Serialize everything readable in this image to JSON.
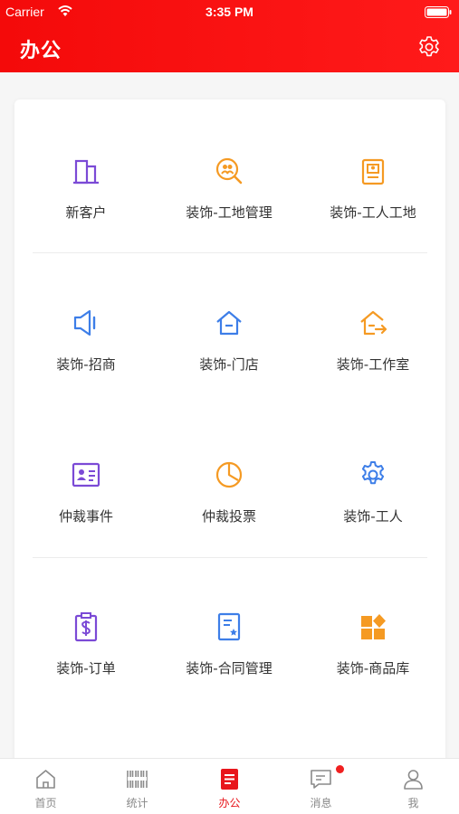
{
  "status_bar": {
    "carrier": "Carrier",
    "time": "3:35 PM"
  },
  "header": {
    "title": "办公",
    "settings_icon": "gear-icon"
  },
  "colors": {
    "header_red": "#f40a0a",
    "purple": "#7b4ad6",
    "orange": "#f59a23",
    "blue": "#3d7ee8",
    "active_red": "#e8161c"
  },
  "grid": [
    {
      "label": "新客户",
      "icon": "building-icon",
      "color": "#7b4ad6"
    },
    {
      "label": "装饰-工地管理",
      "icon": "search-people-icon",
      "color": "#f59a23"
    },
    {
      "label": "装饰-工人工地",
      "icon": "id-card-icon",
      "color": "#f59a23"
    },
    {
      "label": "装饰-招商",
      "icon": "speaker-icon",
      "color": "#3d7ee8"
    },
    {
      "label": "装饰-门店",
      "icon": "home-icon",
      "color": "#3d7ee8"
    },
    {
      "label": "装饰-工作室",
      "icon": "home-export-icon",
      "color": "#f59a23"
    },
    {
      "label": "仲裁事件",
      "icon": "contact-card-icon",
      "color": "#7b4ad6"
    },
    {
      "label": "仲裁投票",
      "icon": "pie-chart-icon",
      "color": "#f59a23"
    },
    {
      "label": "装饰-工人",
      "icon": "gear-icon",
      "color": "#3d7ee8"
    },
    {
      "label": "装饰-订单",
      "icon": "clipboard-dollar-icon",
      "color": "#7b4ad6"
    },
    {
      "label": "装饰-合同管理",
      "icon": "contract-icon",
      "color": "#3d7ee8"
    },
    {
      "label": "装饰-商品库",
      "icon": "grid-diamond-icon",
      "color": "#f59a23"
    }
  ],
  "tabbar": [
    {
      "label": "首页",
      "icon": "home-icon",
      "active": false
    },
    {
      "label": "统计",
      "icon": "barcode-icon",
      "active": false
    },
    {
      "label": "办公",
      "icon": "document-icon",
      "active": true
    },
    {
      "label": "消息",
      "icon": "message-icon",
      "active": false,
      "badge": true
    },
    {
      "label": "我",
      "icon": "user-icon",
      "active": false
    }
  ]
}
